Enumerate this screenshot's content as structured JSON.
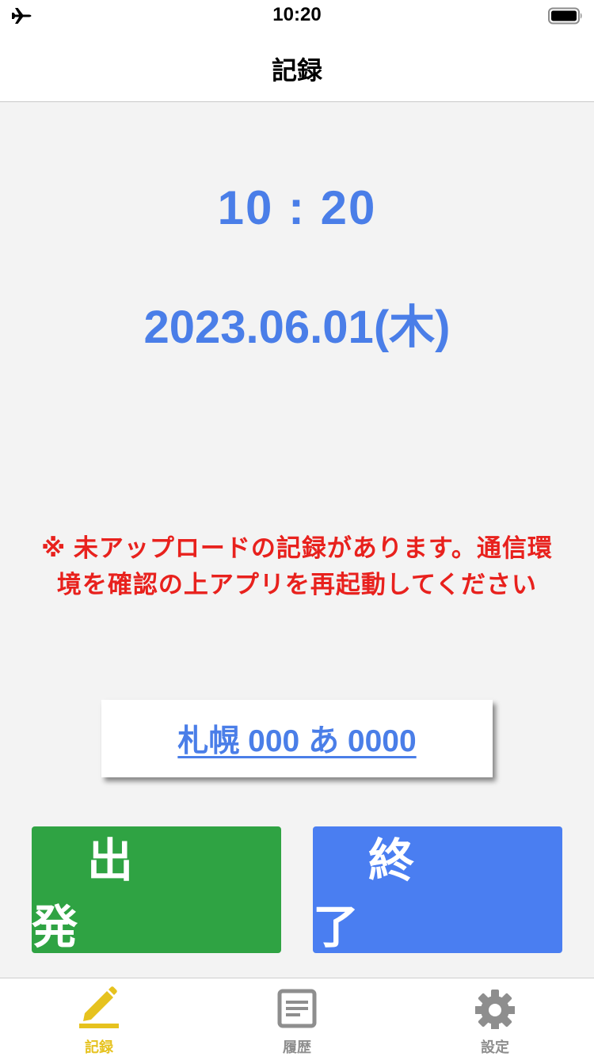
{
  "status_bar": {
    "time": "10:20",
    "left_icon": "airplane-icon",
    "right_icon": "battery-icon"
  },
  "nav": {
    "title": "記録"
  },
  "main": {
    "clock": "10 : 20",
    "date": "2023.06.01(木)",
    "warning": "※ 未アップロードの記録があります。通信環境を確認の上アプリを再起動してください",
    "vehicle": "札幌 000 あ 0000",
    "depart_button": "出発",
    "finish_button": "終了"
  },
  "tab_bar": {
    "items": [
      {
        "label": "記録",
        "icon": "pencil-icon",
        "active": true
      },
      {
        "label": "履歴",
        "icon": "history-icon",
        "active": false
      },
      {
        "label": "設定",
        "icon": "gear-icon",
        "active": false
      }
    ]
  },
  "colors": {
    "accent_blue": "#4a7ee8",
    "warning_red": "#e8211d",
    "depart_green": "#2fa343",
    "finish_blue": "#4a7ef1",
    "tab_active": "#e6c21e",
    "tab_inactive": "#8e8e8e"
  }
}
